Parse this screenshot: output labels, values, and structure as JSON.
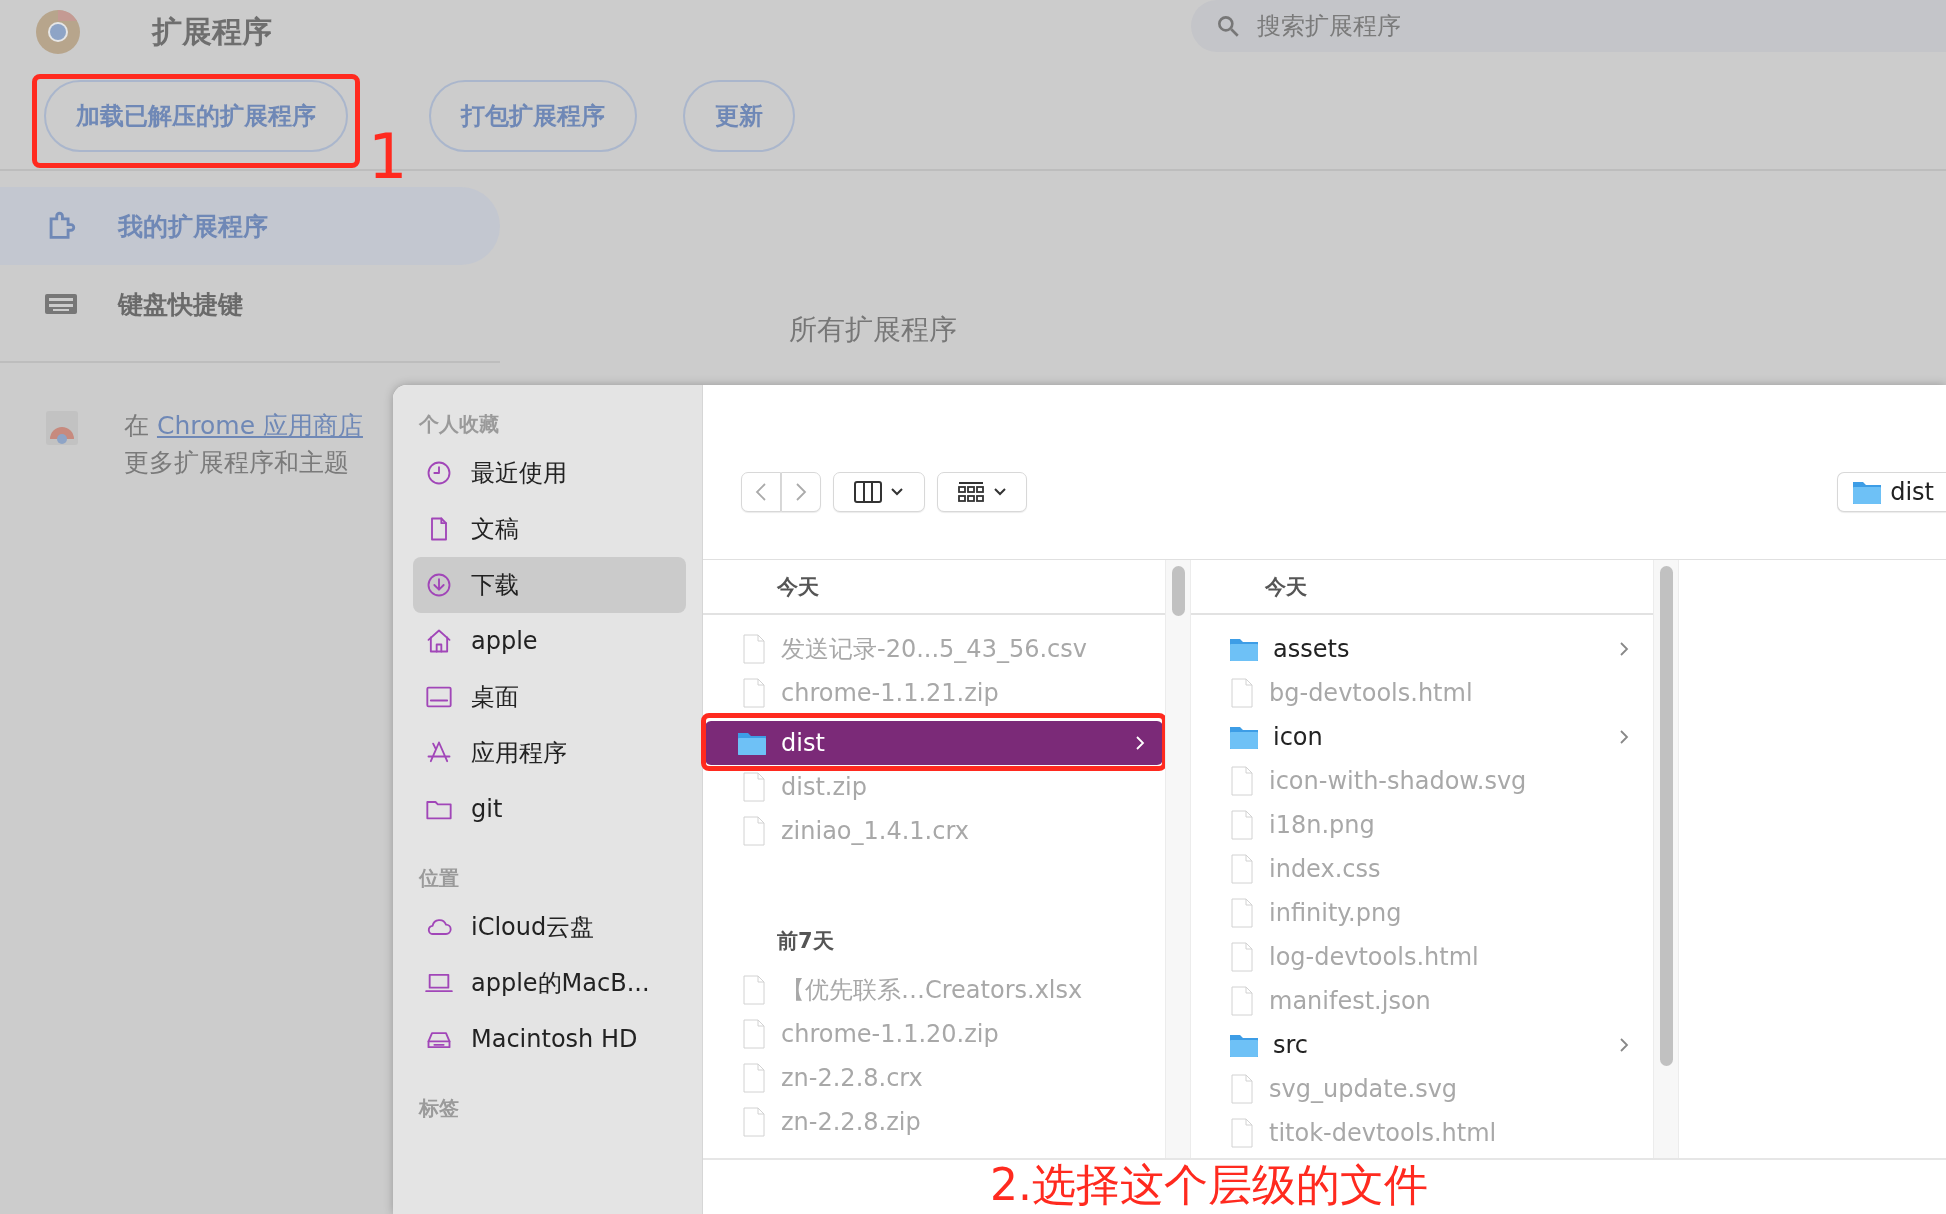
{
  "header": {
    "title": "扩展程序",
    "search_placeholder": "搜索扩展程序"
  },
  "toolbar": {
    "buttons": [
      {
        "label": "加载已解压的扩展程序",
        "highlighted": true
      },
      {
        "label": "打包扩展程序",
        "highlighted": false
      },
      {
        "label": "更新",
        "highlighted": false
      }
    ]
  },
  "sidebar": {
    "items": [
      {
        "label": "我的扩展程序",
        "selected": true
      },
      {
        "label": "键盘快捷键",
        "selected": false
      }
    ],
    "store_promo": {
      "prefix": "在",
      "link": "Chrome 应用商店",
      "line_2": "更多扩展程序和主题"
    }
  },
  "main": {
    "section_title": "所有扩展程序"
  },
  "annotations": {
    "step_1": "1",
    "step_2": "2.选择这个层级的文件"
  },
  "dialog": {
    "sidebar": {
      "sections": [
        {
          "title": "个人收藏",
          "items": [
            {
              "label": "最近使用",
              "selected": false
            },
            {
              "label": "文稿",
              "selected": false
            },
            {
              "label": "下载",
              "selected": true
            },
            {
              "label": "apple",
              "selected": false
            },
            {
              "label": "桌面",
              "selected": false
            },
            {
              "label": "应用程序",
              "selected": false
            },
            {
              "label": "git",
              "selected": false
            }
          ]
        },
        {
          "title": "位置",
          "items": [
            {
              "label": "iCloud云盘",
              "selected": false
            },
            {
              "label": "apple的MacB...",
              "selected": false
            },
            {
              "label": "Macintosh HD",
              "selected": false
            }
          ]
        },
        {
          "title": "标签"
        }
      ]
    },
    "path": "dist",
    "columns": [
      {
        "groups": [
          {
            "title": "今天",
            "items": [
              {
                "name": "发送记录-20...5_43_56.csv",
                "kind": "file",
                "disabled": true,
                "selected": false,
                "highlighted": false
              },
              {
                "name": "chrome-1.1.21.zip",
                "kind": "file",
                "disabled": true,
                "selected": false,
                "highlighted": false
              },
              {
                "name": "dist",
                "kind": "folder",
                "disabled": false,
                "selected": true,
                "highlighted": true
              },
              {
                "name": "dist.zip",
                "kind": "file",
                "disabled": true,
                "selected": false,
                "highlighted": false
              },
              {
                "name": "ziniao_1.4.1.crx",
                "kind": "file",
                "disabled": true,
                "selected": false,
                "highlighted": false
              }
            ]
          },
          {
            "title": "前7天",
            "items": [
              {
                "name": "【优先联系…Creators.xlsx",
                "kind": "file",
                "disabled": true,
                "selected": false,
                "highlighted": false
              },
              {
                "name": "chrome-1.1.20.zip",
                "kind": "file",
                "disabled": true,
                "selected": false,
                "highlighted": false
              },
              {
                "name": "zn-2.2.8.crx",
                "kind": "file",
                "disabled": true,
                "selected": false,
                "highlighted": false
              },
              {
                "name": "zn-2.2.8.zip",
                "kind": "file",
                "disabled": true,
                "selected": false,
                "highlighted": false
              }
            ]
          }
        ]
      },
      {
        "groups": [
          {
            "title": "今天",
            "items": [
              {
                "name": "assets",
                "kind": "folder",
                "disabled": false,
                "selected": false,
                "highlighted": false
              },
              {
                "name": "bg-devtools.html",
                "kind": "file",
                "disabled": true,
                "selected": false,
                "highlighted": false
              },
              {
                "name": "icon",
                "kind": "folder",
                "disabled": false,
                "selected": false,
                "highlighted": false
              },
              {
                "name": "icon-with-shadow.svg",
                "kind": "file",
                "disabled": true,
                "selected": false,
                "highlighted": false
              },
              {
                "name": "i18n.png",
                "kind": "file",
                "disabled": true,
                "selected": false,
                "highlighted": false
              },
              {
                "name": "index.css",
                "kind": "file",
                "disabled": true,
                "selected": false,
                "highlighted": false
              },
              {
                "name": "infinity.png",
                "kind": "file",
                "disabled": true,
                "selected": false,
                "highlighted": false
              },
              {
                "name": "log-devtools.html",
                "kind": "file",
                "disabled": true,
                "selected": false,
                "highlighted": false
              },
              {
                "name": "manifest.json",
                "kind": "file",
                "disabled": true,
                "selected": false,
                "highlighted": false
              },
              {
                "name": "src",
                "kind": "folder",
                "disabled": false,
                "selected": false,
                "highlighted": false
              },
              {
                "name": "svg_update.svg",
                "kind": "file",
                "disabled": true,
                "selected": false,
                "highlighted": false
              },
              {
                "name": "titok-devtools.html",
                "kind": "file",
                "disabled": true,
                "selected": false,
                "highlighted": false
              }
            ]
          }
        ]
      }
    ]
  }
}
